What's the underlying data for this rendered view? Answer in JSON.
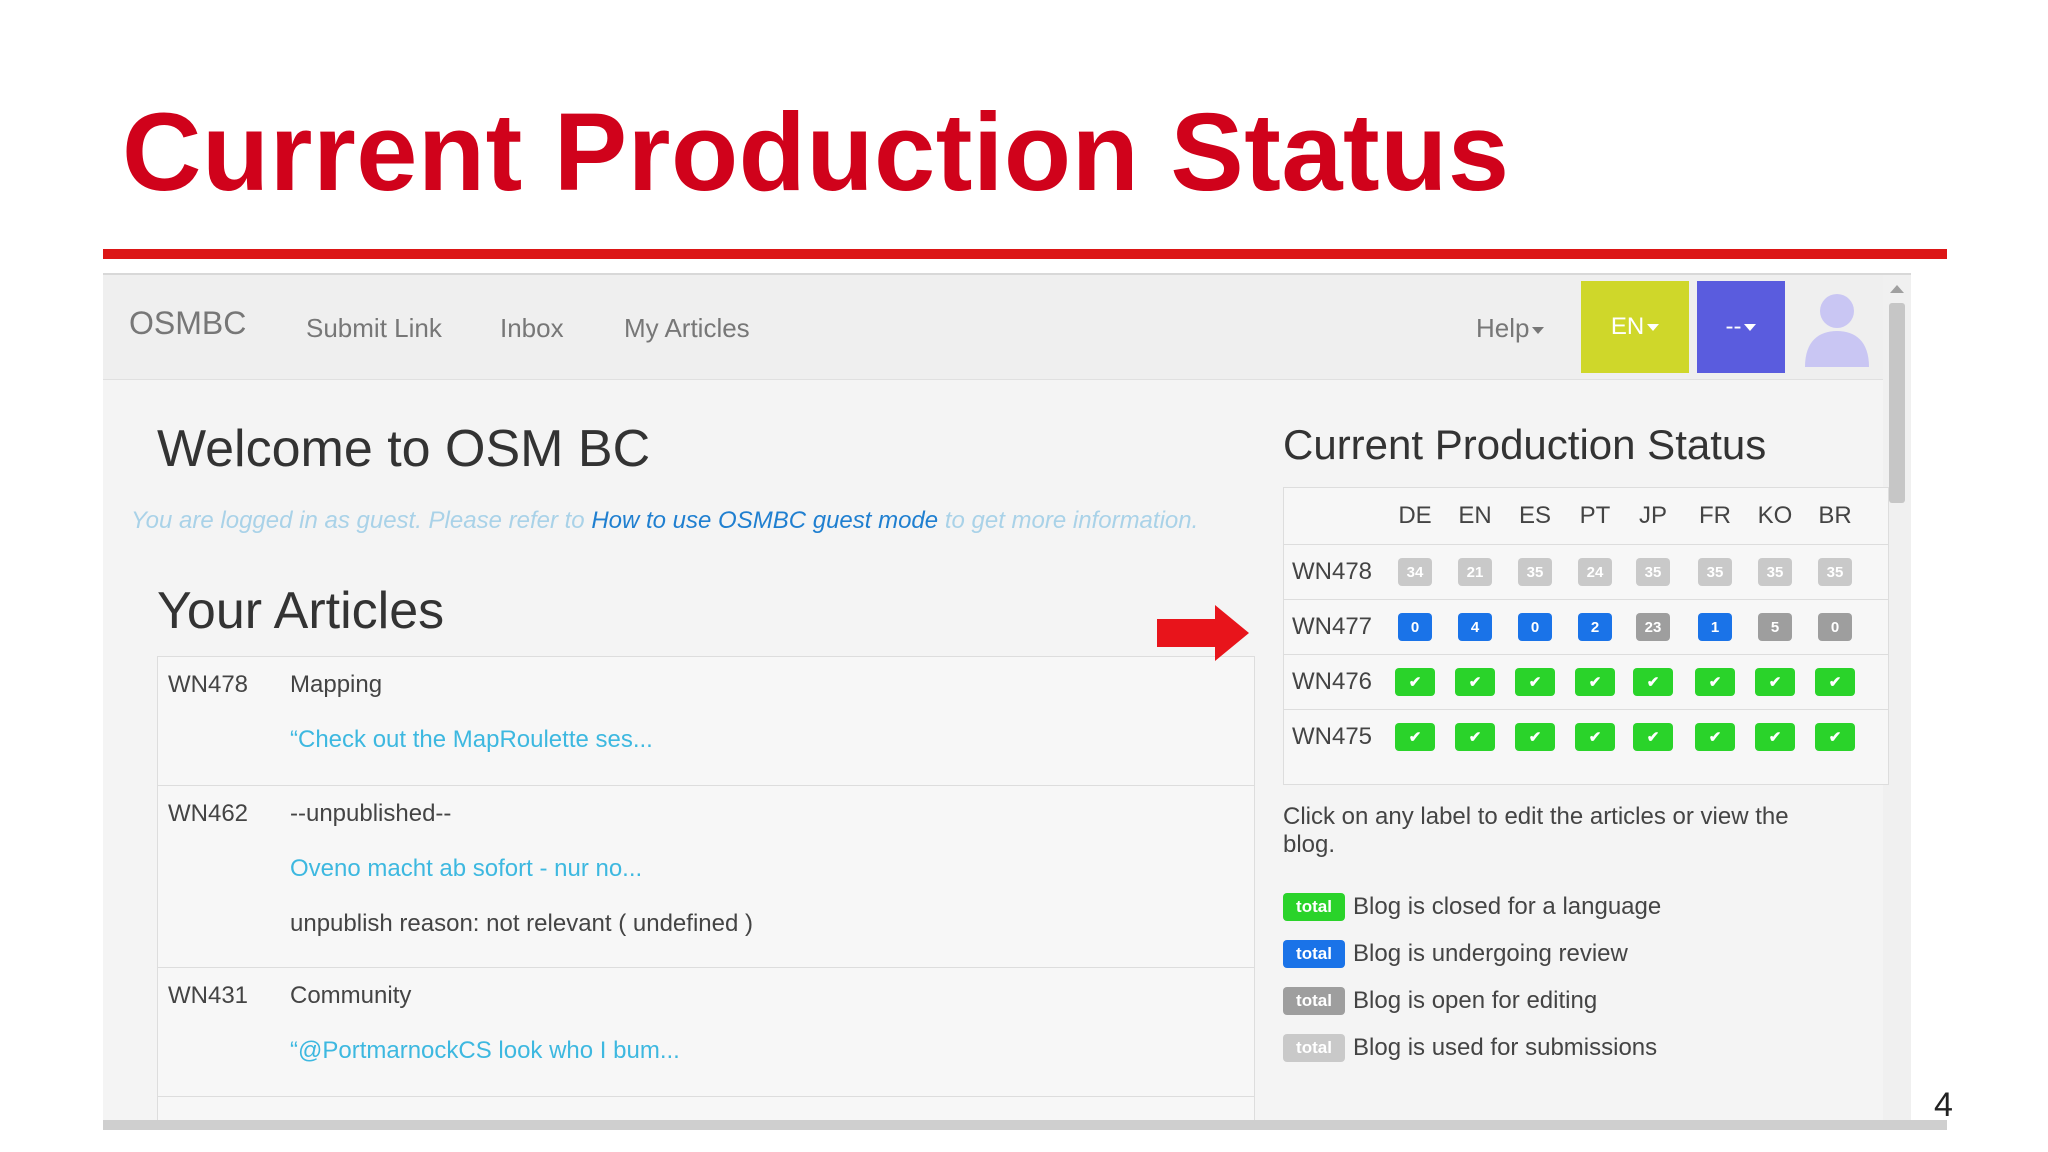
{
  "slide": {
    "title": "Current Production Status",
    "page_number": "4"
  },
  "navbar": {
    "brand": "OSMBC",
    "links": [
      "Submit Link",
      "Inbox",
      "My Articles"
    ],
    "help": "Help",
    "language": "EN",
    "user": "--",
    "colors": {
      "language_button": "#cfd72a",
      "user_button": "#5a5cde"
    }
  },
  "welcome": {
    "title": "Welcome to OSM BC",
    "note_pre": "You are logged in as guest. Please refer to",
    "note_link": "How to use OSMBC guest mode",
    "note_post": "to get more information."
  },
  "your_articles": {
    "title": "Your Articles",
    "rows": [
      {
        "blog": "WN478",
        "lines": [
          {
            "text": "Mapping",
            "link": false
          },
          {
            "text": "“Check out the MapRoulette ses...",
            "link": true
          }
        ]
      },
      {
        "blog": "WN462",
        "lines": [
          {
            "text": "--unpublished--",
            "link": false
          },
          {
            "text": "Oveno macht ab sofort - nur no...",
            "link": true
          },
          {
            "text": "unpublish reason: not relevant ( undefined )",
            "link": false
          }
        ]
      },
      {
        "blog": "WN431",
        "lines": [
          {
            "text": "Community",
            "link": false
          },
          {
            "text": "“@PortmarnockCS look who I bum...",
            "link": true
          }
        ]
      }
    ]
  },
  "production_status": {
    "title": "Current Production Status",
    "languages": [
      "DE",
      "EN",
      "ES",
      "PT",
      "JP",
      "FR",
      "KO",
      "BR"
    ],
    "rows": [
      {
        "blog": "WN478",
        "cells": [
          {
            "v": "34",
            "s": "light"
          },
          {
            "v": "21",
            "s": "light"
          },
          {
            "v": "35",
            "s": "light"
          },
          {
            "v": "24",
            "s": "light"
          },
          {
            "v": "35",
            "s": "light"
          },
          {
            "v": "35",
            "s": "light"
          },
          {
            "v": "35",
            "s": "light"
          },
          {
            "v": "35",
            "s": "light"
          }
        ]
      },
      {
        "blog": "WN477",
        "cells": [
          {
            "v": "0",
            "s": "blue"
          },
          {
            "v": "4",
            "s": "blue"
          },
          {
            "v": "0",
            "s": "blue"
          },
          {
            "v": "2",
            "s": "blue"
          },
          {
            "v": "23",
            "s": "grey"
          },
          {
            "v": "1",
            "s": "blue"
          },
          {
            "v": "5",
            "s": "grey"
          },
          {
            "v": "0",
            "s": "grey"
          }
        ]
      },
      {
        "blog": "WN476",
        "cells": [
          {
            "v": "✔",
            "s": "green"
          },
          {
            "v": "✔",
            "s": "green"
          },
          {
            "v": "✔",
            "s": "green"
          },
          {
            "v": "✔",
            "s": "green"
          },
          {
            "v": "✔",
            "s": "green"
          },
          {
            "v": "✔",
            "s": "green"
          },
          {
            "v": "✔",
            "s": "green"
          },
          {
            "v": "✔",
            "s": "green"
          }
        ]
      },
      {
        "blog": "WN475",
        "cells": [
          {
            "v": "✔",
            "s": "green"
          },
          {
            "v": "✔",
            "s": "green"
          },
          {
            "v": "✔",
            "s": "green"
          },
          {
            "v": "✔",
            "s": "green"
          },
          {
            "v": "✔",
            "s": "green"
          },
          {
            "v": "✔",
            "s": "green"
          },
          {
            "v": "✔",
            "s": "green"
          },
          {
            "v": "✔",
            "s": "green"
          }
        ]
      }
    ],
    "colors": {
      "closed": "#2ad32a",
      "review": "#1a73e8",
      "open": "#9e9e9e",
      "submissions": "#c9c9c9"
    }
  },
  "legend": {
    "intro": "Click on any label to edit the articles or view the blog.",
    "items": [
      {
        "badge": "total",
        "color": "#2ad32a",
        "text": "Blog is closed for a language"
      },
      {
        "badge": "total",
        "color": "#1a73e8",
        "text": "Blog is undergoing review"
      },
      {
        "badge": "total",
        "color": "#9e9e9e",
        "text": "Blog is open for editing"
      },
      {
        "badge": "total",
        "color": "#c9c9c9",
        "text": "Blog is used for submissions"
      }
    ]
  },
  "annotation": {
    "arrow_icon": "red-arrow-right-icon",
    "arrow_color": "#e8141b"
  }
}
